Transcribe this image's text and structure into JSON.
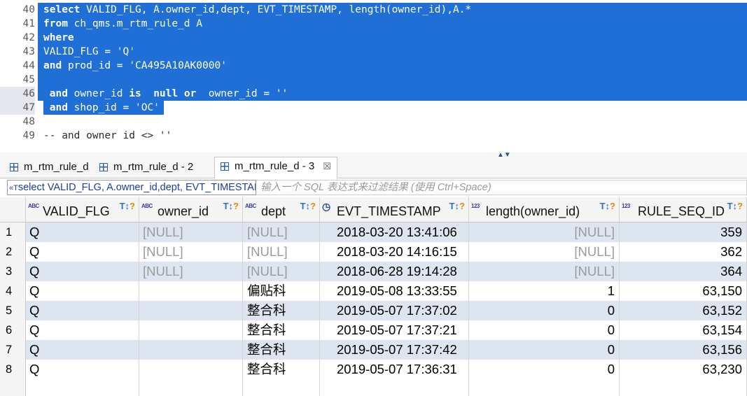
{
  "editor": {
    "lines": [
      {
        "num": "40",
        "text": "select VALID_FLG, A.owner_id,dept, EVT_TIMESTAMP, length(owner_id),A.*",
        "selected": true
      },
      {
        "num": "41",
        "text": "from ch_qms.m_rtm_rule_d A",
        "selected": true
      },
      {
        "num": "42",
        "text": "where",
        "selected": true
      },
      {
        "num": "43",
        "text": "VALID_FLG = 'Q'",
        "selected": true
      },
      {
        "num": "44",
        "text": "and prod_id = 'CA495A10AK0000'",
        "selected": true
      },
      {
        "num": "45",
        "text": "",
        "selected": true
      },
      {
        "num": "46",
        "text": " and owner_id is  null or  owner_id = ''",
        "selected": true
      },
      {
        "num": "47",
        "text": " and shop_id = 'OC'",
        "selected": true
      },
      {
        "num": "48",
        "text": "",
        "selected": false
      },
      {
        "num": "49",
        "text": "-- and owner_id <> ''",
        "selected": false
      }
    ],
    "scroll_left": "<"
  },
  "tabs": [
    {
      "label": "m_rtm_rule_d",
      "active": false
    },
    {
      "label": "m_rtm_rule_d - 2",
      "active": false
    },
    {
      "label": "m_rtm_rule_d - 3",
      "active": true,
      "close": "☒"
    }
  ],
  "minmax": "▲▼",
  "filter": {
    "sql_icon": "«T",
    "sql_text": "select VALID_FLG, A.owner_id,dept, EVT_TIMESTAMP, length(owner_id),A.*",
    "placeholder": "输入一个 SQL 表达式来过滤结果 (使用 Ctrl+Space)"
  },
  "grid": {
    "columns": [
      {
        "name": "VALID_FLG",
        "type": "ABC"
      },
      {
        "name": "owner_id",
        "type": "ABC"
      },
      {
        "name": "dept",
        "type": "ABC"
      },
      {
        "name": "EVT_TIMESTAMP",
        "type": "clock"
      },
      {
        "name": "length(owner_id)",
        "type": "123"
      },
      {
        "name": "RULE_SEQ_ID",
        "type": "123"
      }
    ],
    "filter_sort_icon": "T↕?",
    "rows": [
      {
        "n": "1",
        "cells": [
          "Q",
          "[NULL]",
          "[NULL]",
          "2018-03-20 13:41:06",
          "[NULL]",
          "359"
        ]
      },
      {
        "n": "2",
        "cells": [
          "Q",
          "[NULL]",
          "[NULL]",
          "2018-03-20 14:16:15",
          "[NULL]",
          "362"
        ]
      },
      {
        "n": "3",
        "cells": [
          "Q",
          "[NULL]",
          "[NULL]",
          "2018-06-28 19:14:28",
          "[NULL]",
          "364"
        ]
      },
      {
        "n": "4",
        "cells": [
          "Q",
          "",
          "偏贴科",
          "2019-05-08 13:33:55",
          "1",
          "63,150"
        ]
      },
      {
        "n": "5",
        "cells": [
          "Q",
          "",
          "整合科",
          "2019-05-07 17:37:02",
          "0",
          "63,152"
        ]
      },
      {
        "n": "6",
        "cells": [
          "Q",
          "",
          "整合科",
          "2019-05-07 17:37:21",
          "0",
          "63,154"
        ]
      },
      {
        "n": "7",
        "cells": [
          "Q",
          "",
          "整合科",
          "2019-05-07 17:37:42",
          "0",
          "63,156"
        ]
      },
      {
        "n": "8",
        "cells": [
          "Q",
          "",
          "整合科",
          "2019-05-07 17:36:31",
          "0",
          "63,230"
        ]
      }
    ]
  }
}
